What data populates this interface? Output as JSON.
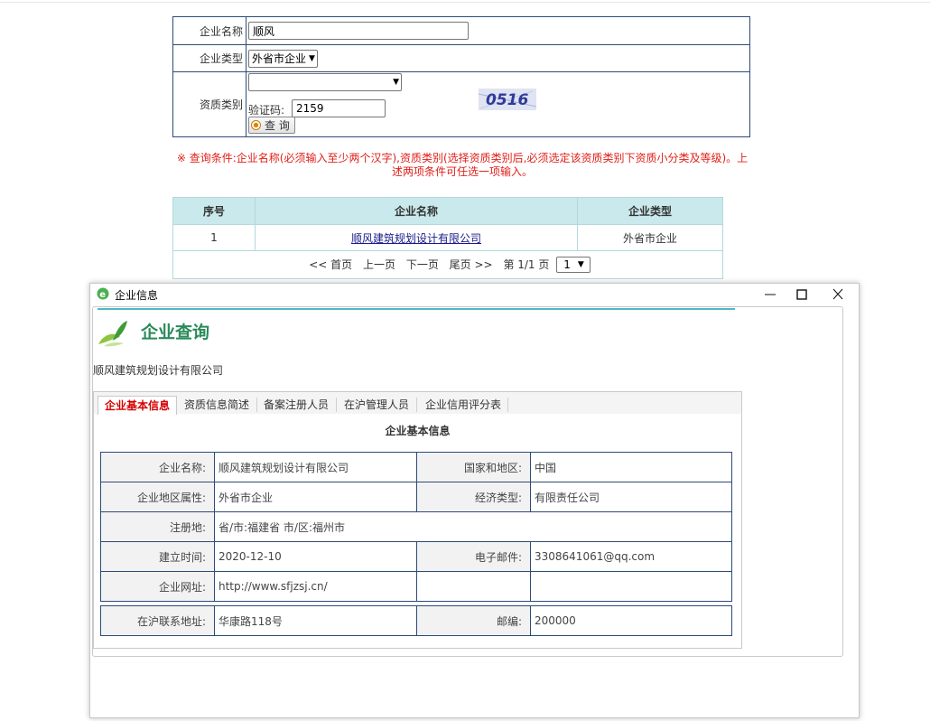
{
  "search": {
    "name_label": "企业名称",
    "name_value": "顺风",
    "type_label": "企业类型",
    "type_value": "外省市企业",
    "qual_label": "资质类别",
    "qual_value": "",
    "captcha_label": "验证码:",
    "captcha_value": "2159",
    "captcha_image_text": "0516",
    "query_button": "查 询"
  },
  "notice": "※ 查询条件:企业名称(必须输入至少两个汉字),资质类别(选择资质类别后,必须选定该资质类别下资质小分类及等级)。上述两项条件可任选一项输入。",
  "results": {
    "headers": [
      "序号",
      "企业名称",
      "企业类型"
    ],
    "rows": [
      {
        "index": "1",
        "name": "顺风建筑规划设计有限公司",
        "type": "外省市企业"
      }
    ],
    "pager": {
      "first": "<< 首页",
      "prev": "上一页",
      "next": "下一页",
      "last": "尾页 >>",
      "page_info": "第 1/1 页",
      "page_select": "1"
    }
  },
  "dialog": {
    "title": "企业信息",
    "brand": "企业查询",
    "company": "顺风建筑规划设计有限公司",
    "tabs": [
      "企业基本信息",
      "资质信息简述",
      "备案注册人员",
      "在沪管理人员",
      "企业信用评分表"
    ],
    "panel_title": "企业基本信息",
    "info": {
      "name_label": "企业名称:",
      "name_value": "顺风建筑规划设计有限公司",
      "country_label": "国家和地区:",
      "country_value": "中国",
      "region_label": "企业地区属性:",
      "region_value": "外省市企业",
      "econ_label": "经济类型:",
      "econ_value": "有限责任公司",
      "reg_label": "注册地:",
      "reg_value": "省/市:福建省 市/区:福州市",
      "date_label": "建立时间:",
      "date_value": "2020-12-10",
      "email_label": "电子邮件:",
      "email_value": "3308641061@qq.com",
      "web_label": "企业网址:",
      "web_value": "http://www.sfjzsj.cn/",
      "addr_label": "在沪联系地址:",
      "addr_value": "华康路118号",
      "zip_label": "邮编:",
      "zip_value": "200000"
    }
  },
  "colors": {
    "accent": "#c9e9ec",
    "notice": "#e0201a",
    "border": "#2e4a78",
    "active_tab": "#d40000",
    "brand": "#2a8a5a"
  }
}
